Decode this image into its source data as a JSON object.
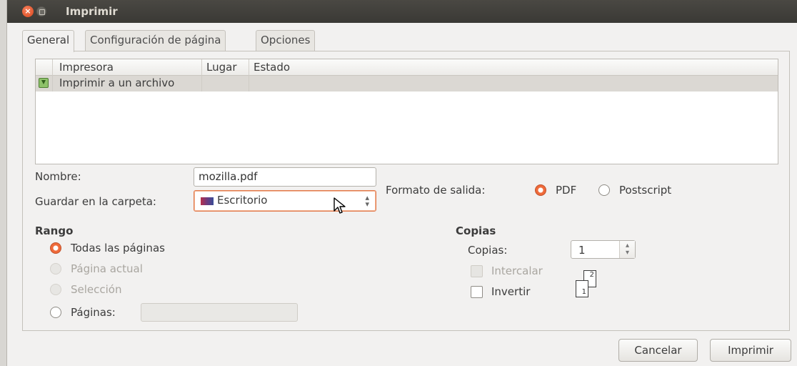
{
  "window": {
    "title": "Imprimir",
    "close_glyph": "×"
  },
  "tabs": [
    {
      "label": "General",
      "active": true
    },
    {
      "label": "Configuración de página",
      "active": false
    },
    {
      "label": "Opciones",
      "active": false
    }
  ],
  "printers": {
    "headers": [
      "Impresora",
      "Lugar",
      "Estado"
    ],
    "rows": [
      {
        "icon": "print-to-file-icon",
        "name": "Imprimir a un archivo",
        "location": "",
        "status": "",
        "selected": true
      }
    ]
  },
  "file": {
    "name_label": "Nombre:",
    "name_value": "mozilla.pdf",
    "folder_label": "Guardar en la carpeta:",
    "folder_value": "Escritorio",
    "folder_icon": "desktop-folder-icon"
  },
  "output_format": {
    "label": "Formato de salida:",
    "options": [
      {
        "label": "PDF",
        "checked": true
      },
      {
        "label": "Postscript",
        "checked": false
      }
    ]
  },
  "range": {
    "heading": "Rango",
    "options": [
      {
        "label": "Todas las páginas",
        "checked": true,
        "enabled": true
      },
      {
        "label": "Página actual",
        "checked": false,
        "enabled": false
      },
      {
        "label": "Selección",
        "checked": false,
        "enabled": false
      },
      {
        "label": "Páginas:",
        "checked": false,
        "enabled": true
      }
    ],
    "pages_value": ""
  },
  "copies": {
    "heading": "Copias",
    "count_label": "Copias:",
    "count_value": "1",
    "collate_label": "Intercalar",
    "collate_checked": false,
    "collate_enabled": false,
    "reverse_label": "Invertir",
    "reverse_checked": false,
    "preview_pages": [
      "1",
      "2"
    ]
  },
  "buttons": {
    "cancel": "Cancelar",
    "print": "Imprimir"
  },
  "colors": {
    "titlebar": "#3c3b37",
    "accent": "#ef6a3a",
    "background": "#f2f1f0"
  }
}
